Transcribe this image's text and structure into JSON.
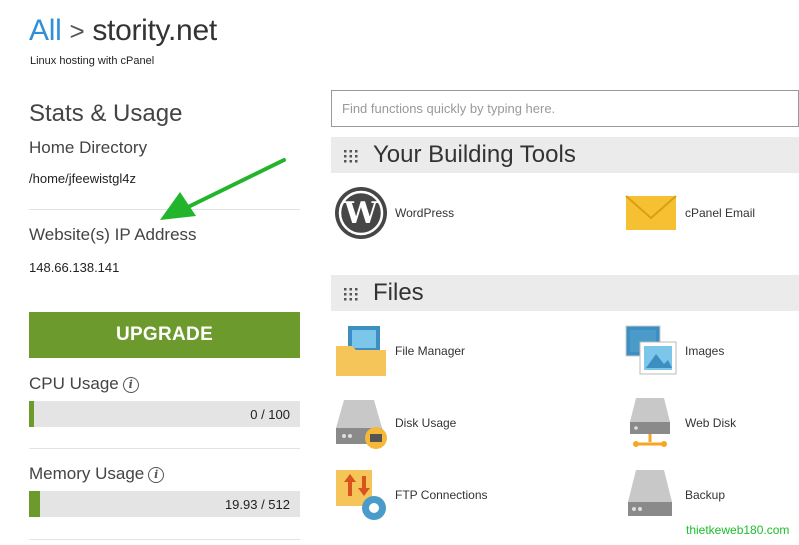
{
  "breadcrumb": {
    "root": "All",
    "separator": ">",
    "current": "stority.net"
  },
  "subtitle": "Linux hosting with cPanel",
  "stats": {
    "title": "Stats & Usage",
    "home_dir_label": "Home Directory",
    "home_dir_value": "/home/jfeewistgl4z",
    "ip_label": "Website(s) IP Address",
    "ip_value": "148.66.138.141",
    "upgrade_label": "UPGRADE",
    "cpu_label": "CPU Usage",
    "cpu_value": "0 / 100",
    "cpu_fraction": 0.0,
    "memory_label": "Memory Usage",
    "memory_value": "19.93 / 512",
    "memory_fraction": 0.039
  },
  "search": {
    "placeholder": "Find functions quickly by typing here."
  },
  "sections": {
    "building": {
      "title": "Your Building Tools",
      "items": [
        {
          "label": "WordPress",
          "icon": "wordpress-icon"
        },
        {
          "label": "cPanel Email",
          "icon": "envelope-icon"
        }
      ]
    },
    "files": {
      "title": "Files",
      "items": [
        {
          "label": "File Manager",
          "icon": "folder-icon"
        },
        {
          "label": "Images",
          "icon": "images-icon"
        },
        {
          "label": "Disk Usage",
          "icon": "disk-icon"
        },
        {
          "label": "Web Disk",
          "icon": "web-disk-icon"
        },
        {
          "label": "FTP Connections",
          "icon": "ftp-icon"
        },
        {
          "label": "Backup",
          "icon": "backup-icon"
        }
      ]
    }
  },
  "watermark": "thietkeweb180.com",
  "colors": {
    "accent": "#2f8fd8",
    "upgrade": "#6c9a2d",
    "annotation_arrow": "#22b52c"
  }
}
